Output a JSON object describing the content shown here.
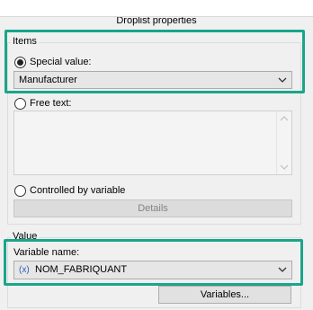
{
  "panel": {
    "title": "Droplist properties"
  },
  "items_group": {
    "legend": "Items",
    "special_value_label": "Special value:",
    "special_value_selected": "Manufacturer",
    "free_text_label": "Free text:",
    "controlled_label": "Controlled by variable",
    "details_button": "Details"
  },
  "value_group": {
    "legend": "Value",
    "variable_name_label": "Variable name:",
    "variable_icon": "(x)",
    "variable_selected": "NOM_FABRIQUANT",
    "variables_button": "Variables..."
  },
  "colors": {
    "highlight": "#1aa58a",
    "variable_icon": "#2f5fb5"
  },
  "icons": [
    "chevron-down-icon",
    "scroll-up-arrow-icon",
    "scroll-down-arrow-icon",
    "variable-icon"
  ]
}
